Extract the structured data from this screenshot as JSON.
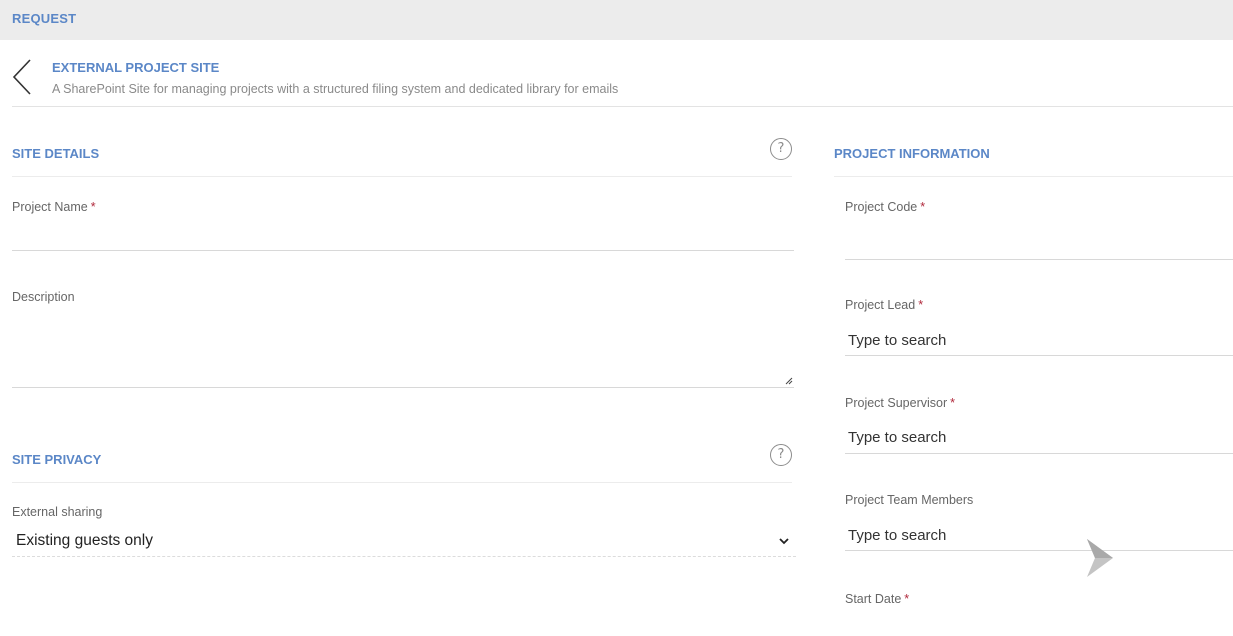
{
  "topbar": {
    "title": "REQUEST"
  },
  "header": {
    "title": "EXTERNAL PROJECT SITE",
    "subtitle": "A SharePoint Site for managing projects with a structured filing system and dedicated library for emails"
  },
  "site_details": {
    "title": "SITE DETAILS",
    "help_glyph": "?",
    "project_name_label": "Project Name",
    "project_name_value": "",
    "description_label": "Description",
    "description_value": ""
  },
  "site_privacy": {
    "title": "SITE PRIVACY",
    "help_glyph": "?",
    "external_sharing_label": "External sharing",
    "external_sharing_value": "Existing guests only"
  },
  "project_information": {
    "title": "PROJECT INFORMATION",
    "project_code_label": "Project Code",
    "project_code_value": "",
    "project_lead_label": "Project Lead",
    "project_lead_placeholder": "Type to search",
    "project_supervisor_label": "Project Supervisor",
    "project_supervisor_placeholder": "Type to search",
    "project_team_members_label": "Project Team Members",
    "project_team_members_placeholder": "Type to search",
    "start_date_label": "Start Date"
  },
  "required_marker": "*",
  "colors": {
    "accent": "#5b87c7",
    "required": "#b0283b",
    "topbar_bg": "#ececec"
  },
  "icons": {
    "back": "chevron-left-icon",
    "help": "question-circle-icon",
    "dropdown": "chevron-down-icon",
    "decorative": "diamond-arrow-icon"
  }
}
